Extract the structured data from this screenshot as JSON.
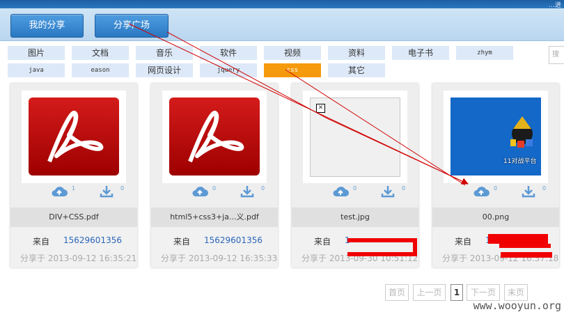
{
  "header": {
    "corner_text": "…进",
    "tabs": [
      {
        "label": "我的分享"
      },
      {
        "label": "分享广场"
      }
    ]
  },
  "categories": [
    {
      "label": "图片"
    },
    {
      "label": "文档"
    },
    {
      "label": "音乐"
    },
    {
      "label": "软件"
    },
    {
      "label": "视频"
    },
    {
      "label": "资料"
    },
    {
      "label": "电子书"
    },
    {
      "label": "zhym"
    },
    {
      "label": "java"
    },
    {
      "label": "eason"
    },
    {
      "label": "网页设计"
    },
    {
      "label": "jquery"
    },
    {
      "label": "css",
      "active": true
    },
    {
      "label": "其它"
    }
  ],
  "search": {
    "placeholder": "搜"
  },
  "cards": [
    {
      "name": "DIV+CSS.pdf",
      "from_label": "来自",
      "user": "15629601356",
      "date": "分享于 2013-09-12 16:35:21",
      "saves": "1",
      "downloads": "0",
      "thumb": "pdf"
    },
    {
      "name": "html5+css3+ja...义.pdf",
      "from_label": "来自",
      "user": "15629601356",
      "date": "分享于 2013-09-12 16:35:33",
      "saves": "0",
      "downloads": "0",
      "thumb": "pdf"
    },
    {
      "name": "test.jpg",
      "from_label": "来自",
      "user": "1",
      "date": "分享于 2013-09-30 10:51:12",
      "saves": "0",
      "downloads": "0",
      "thumb": "broken"
    },
    {
      "name": "00.png",
      "from_label": "来自",
      "user": "12",
      "date": "分享于 2013-09-12 16:37:18",
      "saves": "0",
      "downloads": "0",
      "thumb": "desktop",
      "desktop_label": "11对战平台"
    }
  ],
  "pagination": {
    "first": "首页",
    "prev": "上一页",
    "current": "1",
    "next": "下一页",
    "last": "末页"
  },
  "watermark": "www.wooyun.org",
  "colors": {
    "accent": "#2a78c3",
    "active_category": "#f59a0c",
    "redaction": "#f00000",
    "arrow": "#d00000"
  }
}
